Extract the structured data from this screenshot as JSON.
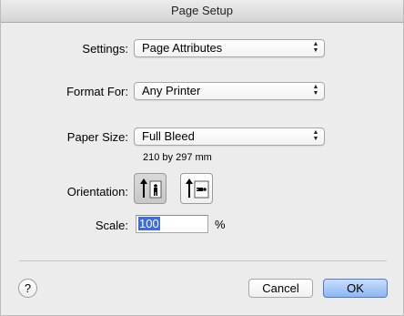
{
  "window": {
    "title": "Page Setup"
  },
  "settings": {
    "label": "Settings:",
    "value": "Page Attributes"
  },
  "format_for": {
    "label": "Format For:",
    "value": "Any Printer"
  },
  "paper_size": {
    "label": "Paper Size:",
    "value": "Full Bleed",
    "dimensions": "210 by 297 mm"
  },
  "orientation": {
    "label": "Orientation:",
    "selected": "portrait",
    "options": [
      "portrait",
      "landscape"
    ]
  },
  "scale": {
    "label": "Scale:",
    "value": "100",
    "unit": "%"
  },
  "buttons": {
    "help": "?",
    "cancel": "Cancel",
    "ok": "OK"
  },
  "colors": {
    "selection": "#3d6cdb",
    "default_button": "#8cb6f2"
  }
}
